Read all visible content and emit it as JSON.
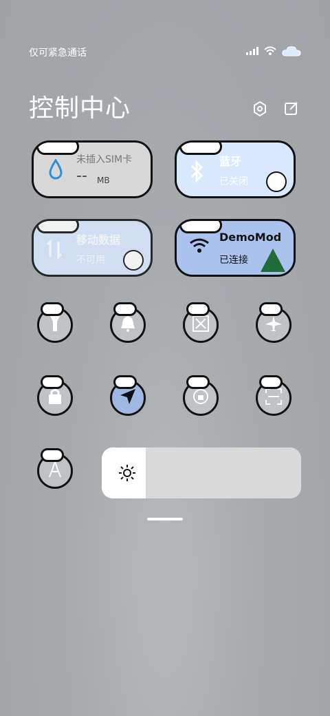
{
  "status_bar": {
    "carrier": "仅可紧急通话",
    "icons": [
      "signal-icon",
      "wifi-icon",
      "cloud-icon"
    ]
  },
  "header": {
    "title": "控制中心",
    "settings_icon": "settings-icon",
    "edit_icon": "edit-icon"
  },
  "cards": {
    "sim": {
      "main": "未插入SIM卡",
      "value": "--",
      "unit": "MB",
      "icon": "water-drop-icon"
    },
    "bluetooth": {
      "main": "蓝牙",
      "sub": "已关闭",
      "icon": "bluetooth-icon"
    },
    "mobile_data": {
      "main": "移动数据",
      "sub": "不可用",
      "icon": "data-arrows-icon"
    },
    "wifi": {
      "main": "DemoMod",
      "sub": "已连接",
      "icon": "wifi-icon"
    }
  },
  "toggles_row1": [
    {
      "name": "flashlight",
      "icon": "flashlight-icon"
    },
    {
      "name": "bell",
      "icon": "bell-icon"
    },
    {
      "name": "screenshot",
      "icon": "cut-icon"
    },
    {
      "name": "airplane",
      "icon": "airplane-icon"
    }
  ],
  "toggles_row2": [
    {
      "name": "lock",
      "icon": "lock-icon"
    },
    {
      "name": "location",
      "icon": "location-icon"
    },
    {
      "name": "rotate",
      "icon": "rotate-icon"
    },
    {
      "name": "scan",
      "icon": "scan-icon"
    }
  ],
  "toggles_row3": [
    {
      "name": "auto-brightness",
      "icon": "a-icon"
    }
  ],
  "brightness": {
    "level": 0.22,
    "icon": "sun-icon"
  },
  "colors": {
    "card_grey": "#d8d8d8",
    "card_lightblue": "#d9e8ff",
    "card_blue": "#a9c2ee",
    "toggle_grey": "#bfc3c6",
    "toggle_blue": "#9fb8e2"
  }
}
